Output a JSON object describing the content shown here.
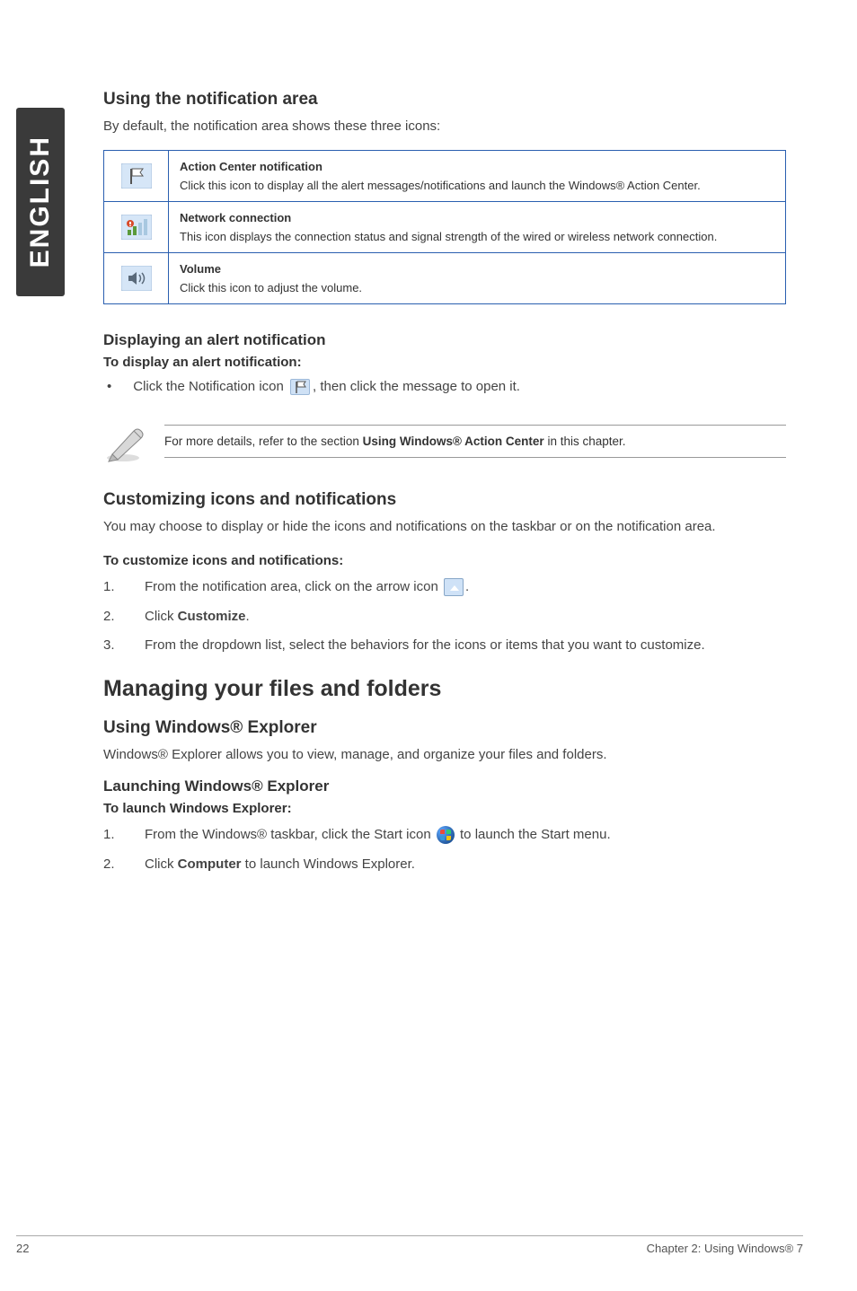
{
  "sidebar": {
    "language": "ENGLISH"
  },
  "section1": {
    "heading": "Using the notification area",
    "intro": "By default, the notification area shows these three icons:",
    "rows": [
      {
        "title": "Action Center notification",
        "desc": "Click this icon to display all the alert messages/notifications and launch the Windows® Action Center."
      },
      {
        "title": "Network connection",
        "desc": "This icon displays the connection status and signal strength of the wired or wireless network connection."
      },
      {
        "title": "Volume",
        "desc": "Click this icon to adjust the volume."
      }
    ]
  },
  "section2": {
    "heading": "Displaying an alert notification",
    "sub": "To display an alert notification:",
    "bullet_pre": "Click the Notification icon",
    "bullet_post": ", then click the message to open it.",
    "note_pre": "For more details, refer to the section ",
    "note_bold": "Using Windows® Action Center",
    "note_post": " in this chapter."
  },
  "section3": {
    "heading": "Customizing icons and notifications",
    "intro": "You may choose to display or hide the icons and notifications on the taskbar or on the notification area.",
    "sub": "To customize icons and notifications:",
    "items": [
      {
        "num": "1.",
        "pre": "From the notification area, click on the arrow icon",
        "post": "."
      },
      {
        "num": "2.",
        "pre": "Click ",
        "bold": "Customize",
        "post": "."
      },
      {
        "num": "3.",
        "text": "From the dropdown list, select the behaviors for the icons or items that you want to customize."
      }
    ]
  },
  "section4": {
    "heading": "Managing your files and folders",
    "sub1": "Using Windows® Explorer",
    "intro": "Windows® Explorer allows you to view, manage, and organize your files and folders.",
    "sub2": "Launching Windows® Explorer",
    "sub3": "To launch Windows Explorer:",
    "items": [
      {
        "num": "1.",
        "pre": "From the Windows® taskbar, click the Start icon ",
        "post": " to launch the Start menu."
      },
      {
        "num": "2.",
        "pre": "Click ",
        "bold": "Computer",
        "post": " to launch Windows Explorer."
      }
    ]
  },
  "footer": {
    "page": "22",
    "chapter": "Chapter 2: Using Windows® 7"
  }
}
